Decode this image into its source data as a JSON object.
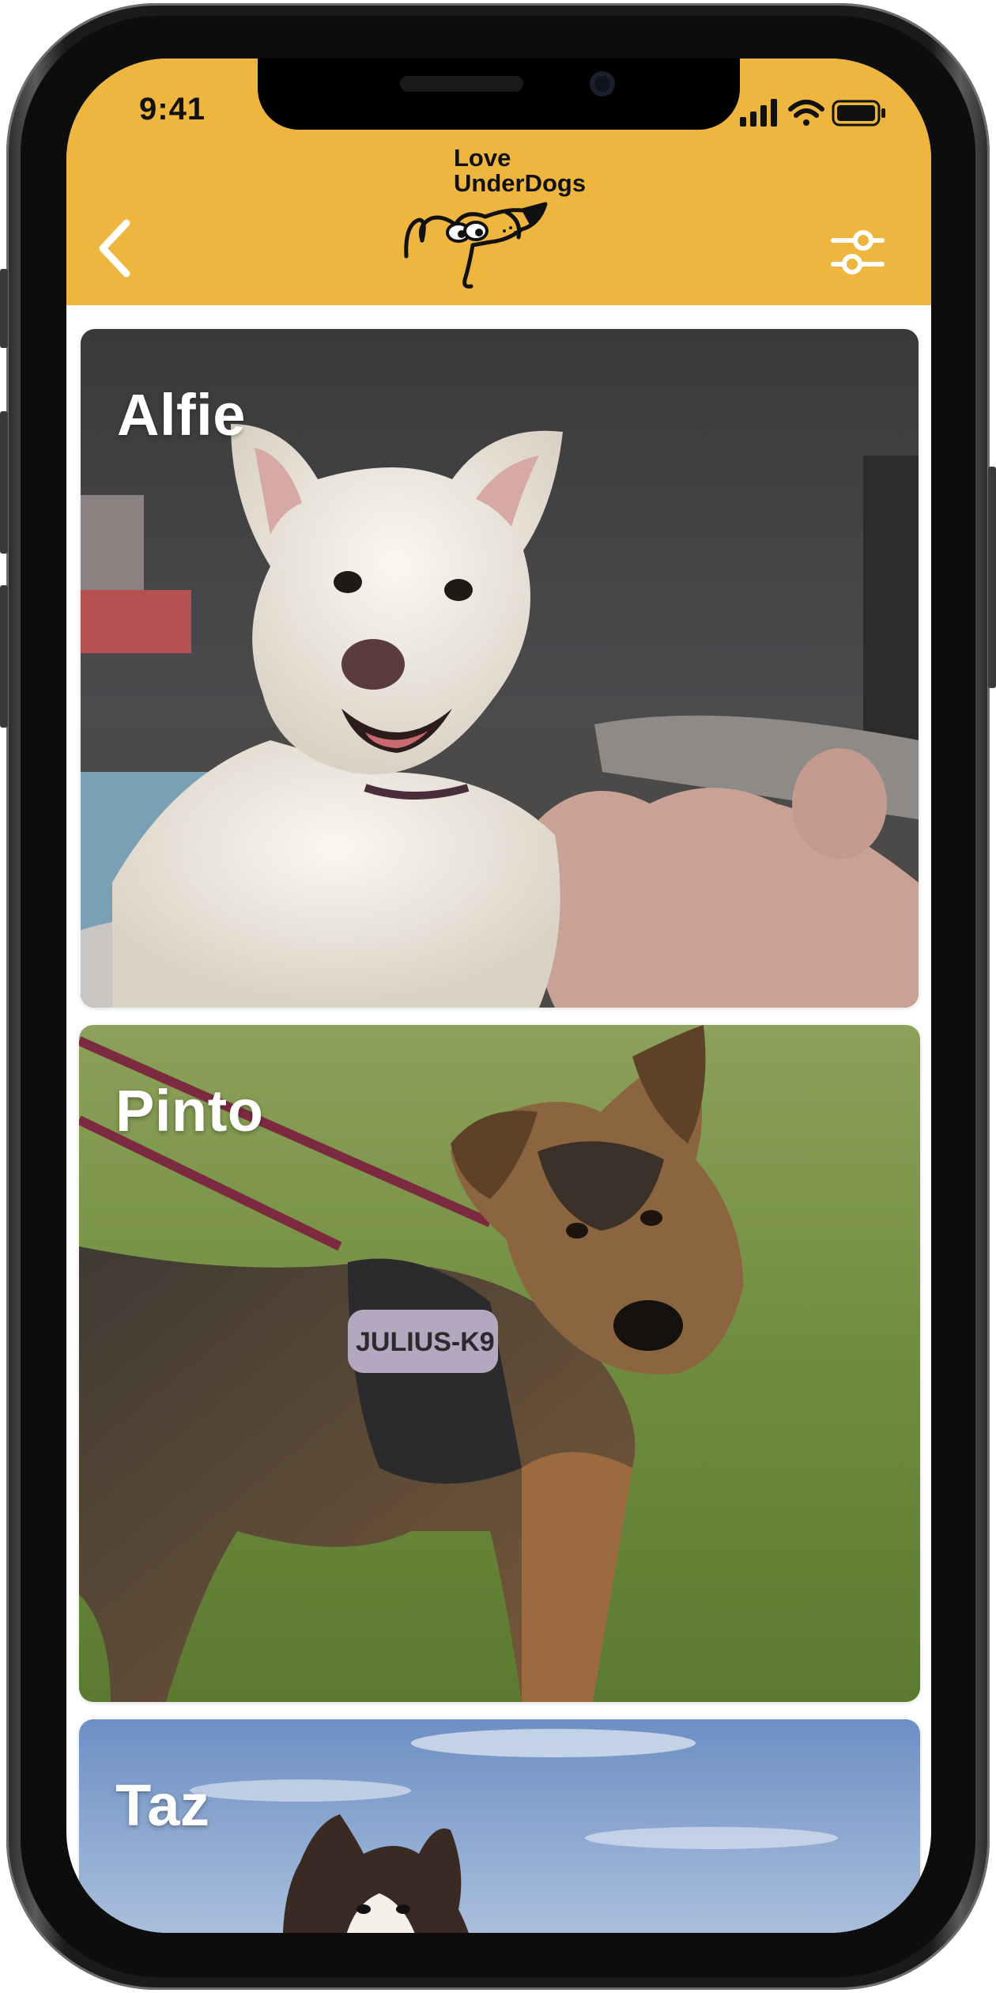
{
  "status_bar": {
    "time": "9:41",
    "icons": [
      "cellular-signal-icon",
      "wifi-icon",
      "battery-icon"
    ]
  },
  "header": {
    "background": "#EEB63E",
    "back_icon": "chevron-left-icon",
    "filter_icon": "sliders-icon",
    "logo": {
      "line1": "Love",
      "line2": "UnderDogs"
    }
  },
  "dogs": [
    {
      "name": "Alfie"
    },
    {
      "name": "Pinto"
    },
    {
      "name": "Taz"
    }
  ]
}
